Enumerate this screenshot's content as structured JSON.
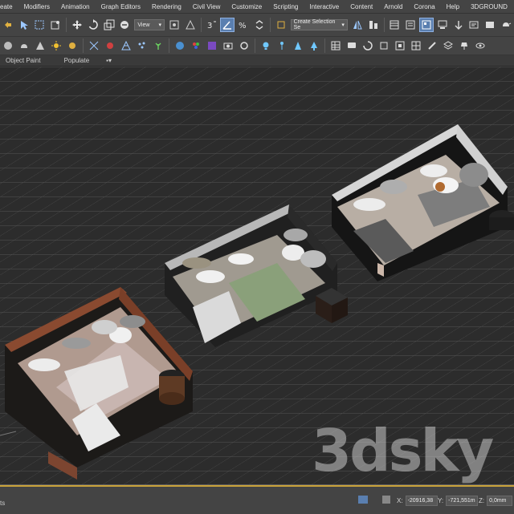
{
  "menubar": {
    "items": [
      "eate",
      "Modifiers",
      "Animation",
      "Graph Editors",
      "Rendering",
      "Civil View",
      "Customize",
      "Scripting",
      "Interactive",
      "Content",
      "Arnold",
      "Corona",
      "Help",
      "3DGROUND"
    ]
  },
  "toolbar": {
    "view_dropdown": "View",
    "selection_set_dropdown": "Create Selection Se",
    "icons_row1": [
      "undo-icon",
      "select-icon",
      "select-region-icon",
      "window-crossing-icon",
      "move-icon",
      "rotate-icon",
      "scale-icon",
      "select-and-place-icon",
      "view-dropdown",
      "pivot-icon",
      "select-manipulate-icon",
      "snaps-toggle-icon",
      "angle-snap-icon",
      "percent-snap-icon",
      "spinner-snap-icon",
      "selection-set-dropdown",
      "mirror-icon",
      "align-icon",
      "layer-explorer-icon",
      "toggle-ribbon-icon",
      "curve-editor-icon",
      "schematic-view-icon",
      "material-editor-icon",
      "render-setup-icon",
      "render-frame-icon",
      "render-icon",
      "teapot-icon"
    ]
  },
  "ribbon": {
    "tabs": [
      "Object Paint",
      "Populate"
    ]
  },
  "status": {
    "left_text": "ts",
    "x_label": "X:",
    "x_value": "-20916,38",
    "y_label": "Y:",
    "y_value": "-721,551m",
    "z_label": "Z:",
    "z_value": "0,0mm"
  },
  "watermark": "3dsky",
  "colors": {
    "ui_bg": "#444444",
    "viewport_bg": "#2c2c2c",
    "grid": "#555555",
    "active_btn": "#5a7fb0",
    "timeline": "#c9a23a"
  }
}
